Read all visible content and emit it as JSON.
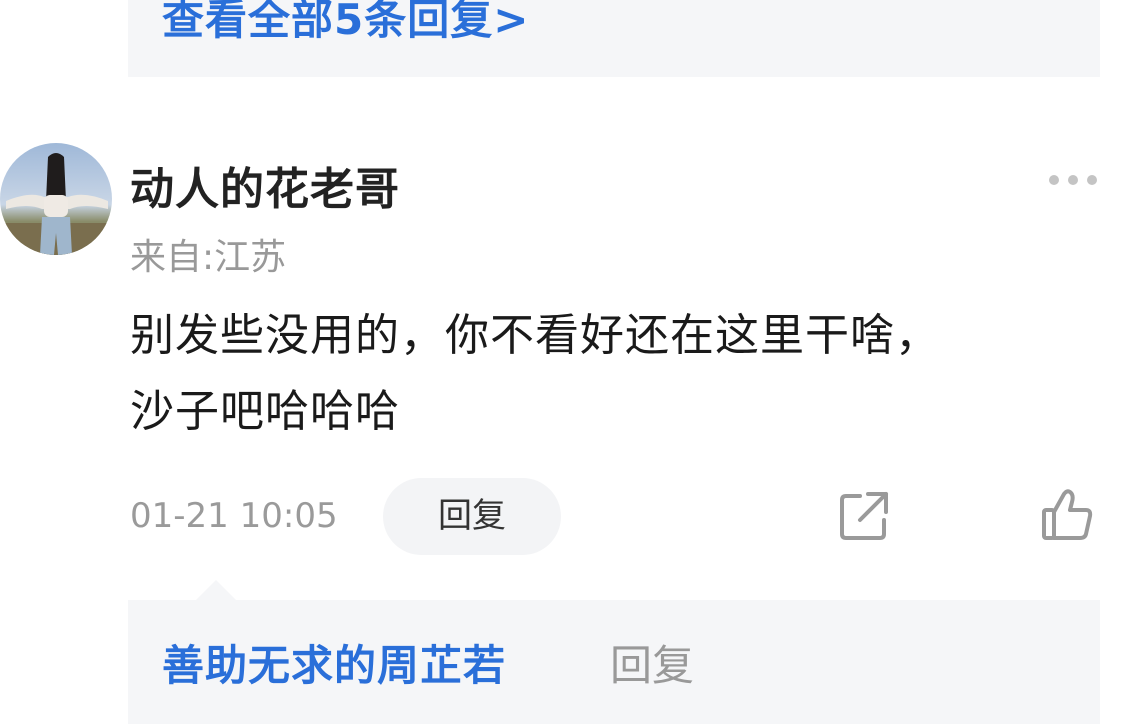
{
  "previous_thread": {
    "view_all_replies": "查看全部5条回复>"
  },
  "comment": {
    "username": "动人的花老哥",
    "location": "来自:江苏",
    "text_line1": "别发些没用的，你不看好还在这里干啥，",
    "text_line2": "沙子吧哈哈哈",
    "timestamp": "01-21 10:05",
    "reply_label": "回复"
  },
  "sub_reply": {
    "author": "善助无求的周芷若",
    "action_label": "回复"
  },
  "colors": {
    "link_blue": "#2a6fd9",
    "secondary_gray": "#999999",
    "box_background": "#f5f6f8",
    "text_dark": "#1a1a1a"
  },
  "icons": [
    "more-dots-icon",
    "share-icon",
    "thumbs-up-icon"
  ]
}
